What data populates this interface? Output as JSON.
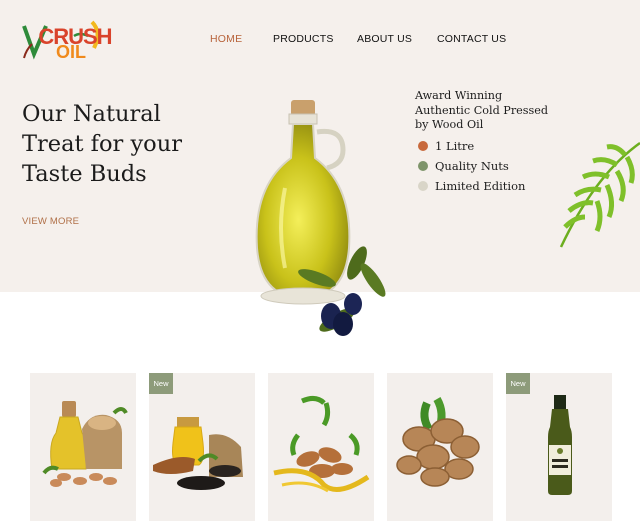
{
  "brand": {
    "logo_v": "V",
    "logo_crush": "CRUSH",
    "logo_oil": "OIL"
  },
  "nav": {
    "home": "HOME",
    "products": "PRODUCTS",
    "about": "ABOUT US",
    "contact": "CONTACT US"
  },
  "hero": {
    "title_line1": "Our Natural",
    "title_line2": "Treat for your",
    "title_line3": "Taste Buds",
    "view_more": "VIEW MORE",
    "award_line1": "Award Winning",
    "award_line2": "Authentic Cold Pressed",
    "award_line3": "by Wood Oil",
    "features": [
      "1 Litre",
      "Quality Nuts",
      "Limited Edition"
    ]
  },
  "colors": {
    "accent": "#b8643c",
    "dot1": "#c8693c",
    "dot2": "#7e946a",
    "dot3": "#d9d5c8",
    "badge": "#8d9b7a"
  },
  "products": [
    {
      "badge": "",
      "image": "groundnut-oil-icon"
    },
    {
      "badge": "New",
      "image": "sesame-oil-icon"
    },
    {
      "badge": "",
      "image": "almond-oil-icon"
    },
    {
      "badge": "",
      "image": "walnut-icon"
    },
    {
      "badge": "New",
      "image": "olive-oil-bottle-icon"
    }
  ]
}
